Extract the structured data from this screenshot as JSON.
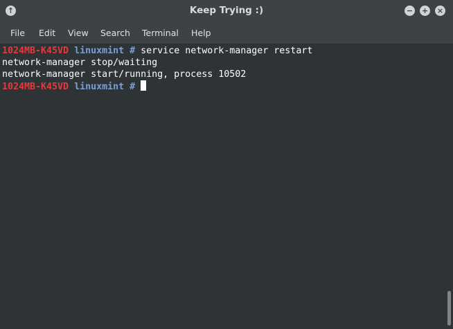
{
  "window": {
    "title": "Keep Trying :)"
  },
  "menu": [
    {
      "label": "File"
    },
    {
      "label": "Edit"
    },
    {
      "label": "View"
    },
    {
      "label": "Search"
    },
    {
      "label": "Terminal"
    },
    {
      "label": "Help"
    }
  ],
  "terminal": {
    "lines": [
      {
        "host": "1024MB-K45VD",
        "dir": "linuxmint #",
        "command": " service network-manager restart"
      },
      {
        "output": "network-manager stop/waiting"
      },
      {
        "output": "network-manager start/running, process 10502"
      },
      {
        "host": "1024MB-K45VD",
        "dir": "linuxmint #",
        "command": " "
      }
    ]
  },
  "colors": {
    "host": "#e8383b",
    "dir": "#7aa0d6",
    "background": "#2e3336"
  },
  "icons": {
    "window_menu": "arrow-up-icon",
    "minimize": "minimize-icon",
    "maximize": "maximize-icon",
    "close": "close-icon"
  }
}
